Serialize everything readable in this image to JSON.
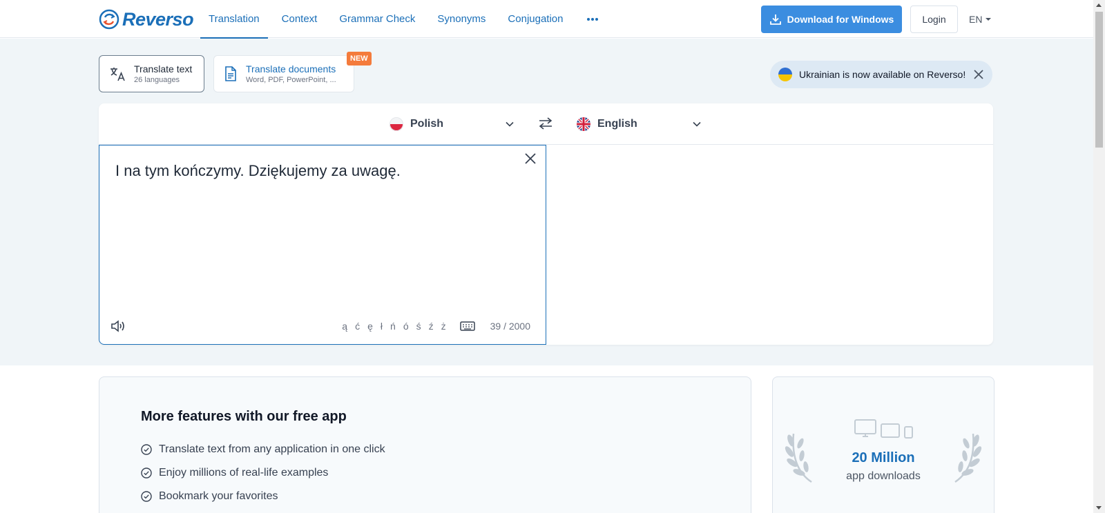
{
  "header": {
    "logo_text": "Reverso",
    "nav": [
      {
        "label": "Translation",
        "active": true
      },
      {
        "label": "Context"
      },
      {
        "label": "Grammar Check"
      },
      {
        "label": "Synonyms"
      },
      {
        "label": "Conjugation"
      }
    ],
    "download_label": "Download for Windows",
    "login_label": "Login",
    "ui_language": "EN"
  },
  "modes": {
    "text": {
      "title": "Translate text",
      "subtitle": "26 languages"
    },
    "docs": {
      "title": "Translate documents",
      "subtitle": "Word, PDF, PowerPoint, ...",
      "badge": "NEW"
    }
  },
  "notice": {
    "text": "Ukrainian is now available on Reverso!"
  },
  "translator": {
    "source_language": "Polish",
    "target_language": "English",
    "source_text": "I na tym kończymy. Dziękujemy za uwagę.",
    "special_chars": [
      "ą",
      "ć",
      "ę",
      "ł",
      "ń",
      "ó",
      "ś",
      "ź",
      "ż"
    ],
    "char_count": "39 / 2000"
  },
  "features": {
    "title": "More features with our free app",
    "items": [
      "Translate text from any application in one click",
      "Enjoy millions of real-life examples",
      "Bookmark your favorites"
    ]
  },
  "downloads": {
    "count": "20 Million",
    "label": "app downloads"
  },
  "colors": {
    "brand": "#1b6fb8",
    "download_button": "#3b8de0",
    "new_badge": "#f47b3c",
    "hero_bg": "#f0f5f8"
  }
}
